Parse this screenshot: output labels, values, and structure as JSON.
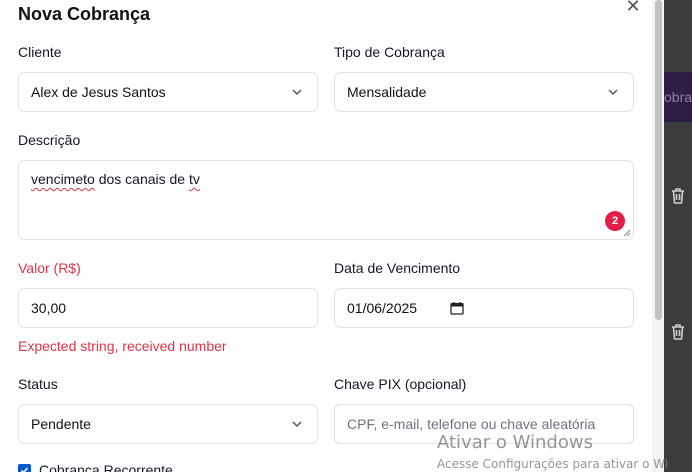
{
  "modal": {
    "title": "Nova Cobrança",
    "close_icon": "close-icon"
  },
  "form": {
    "cliente": {
      "label": "Cliente",
      "value": "Alex de Jesus Santos"
    },
    "tipo": {
      "label": "Tipo de Cobrança",
      "value": "Mensalidade"
    },
    "descricao": {
      "label": "Descrição",
      "value_parts": [
        "vencimeto",
        " dos canais de ",
        "tv"
      ],
      "badge": "2"
    },
    "valor": {
      "label": "Valor (R$)",
      "value": "30,00",
      "error": "Expected string, received number"
    },
    "vencimento": {
      "label": "Data de Vencimento",
      "value": "01/06/2025"
    },
    "status": {
      "label": "Status",
      "value": "Pendente"
    },
    "pix": {
      "label": "Chave PIX (opcional)",
      "placeholder": "CPF, e-mail, telefone ou chave aleatória"
    },
    "recorrente": {
      "label": "Cobrança Recorrente",
      "checked": true
    }
  },
  "background": {
    "button_text": "obran"
  },
  "watermark": {
    "line1": "Ativar o Windows",
    "line2": "Acesse Configurações para ativar o Wi"
  },
  "colors": {
    "error": "#dc3545",
    "badge": "#e11d48",
    "checkbox": "#0b57d0"
  }
}
